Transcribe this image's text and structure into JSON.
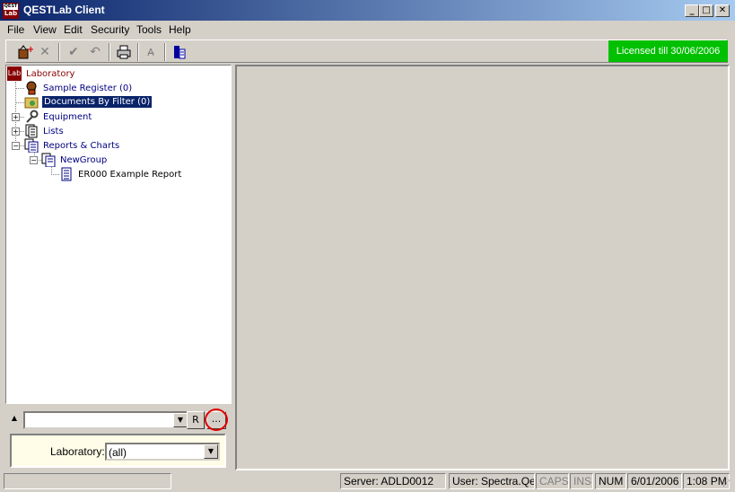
{
  "window": {
    "title": "QESTLab Client",
    "icon_top": "QEST",
    "icon_bottom": "Lab",
    "minimize": "_",
    "maximize": "□",
    "close": "✕"
  },
  "menu": [
    "File",
    "View",
    "Edit",
    "Security",
    "Tools",
    "Help"
  ],
  "license": "Licensed till 30/06/2006",
  "tree": {
    "root": {
      "label": "Laboratory",
      "icon_text": "Lab"
    },
    "sample_register": "Sample Register (0)",
    "documents_by_filter": "Documents By Filter (0)",
    "equipment": "Equipment",
    "lists": "Lists",
    "reports_charts": "Reports & Charts",
    "newgroup": "NewGroup",
    "example_report": "ER000 Example Report"
  },
  "filter": {
    "combo_value": "",
    "r_button": "R",
    "ellipsis_button": "...",
    "lab_label": "Laboratory:",
    "lab_value": "(all)"
  },
  "status": {
    "server": "Server: ADLD0012",
    "user": "User: Spectra.Qest",
    "caps": "CAPS",
    "ins": "INS",
    "num": "NUM",
    "date": "6/01/2006",
    "time": "1:08 PM"
  },
  "colors": {
    "license_bg": "#00c000",
    "selection": "#0a246a",
    "highlight_circle": "#e00000"
  }
}
